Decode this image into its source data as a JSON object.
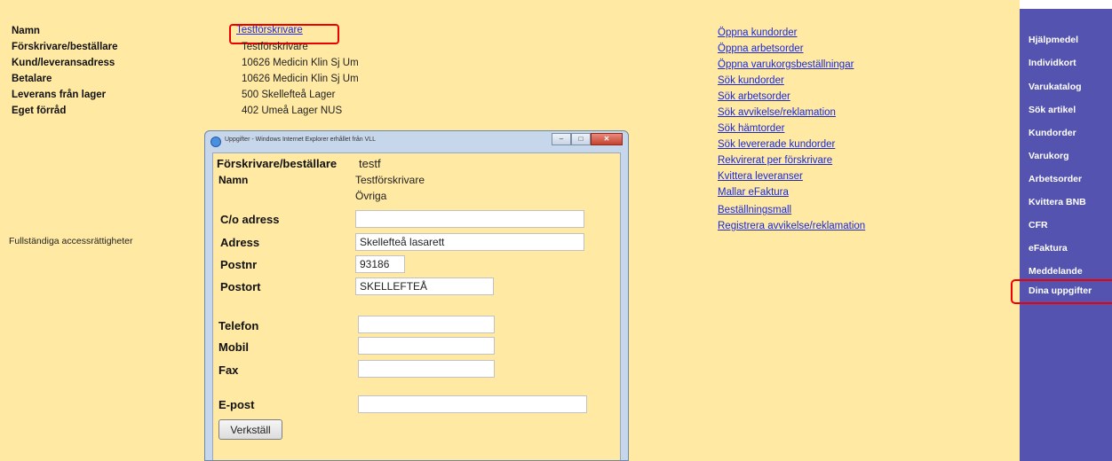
{
  "info": {
    "rows": [
      {
        "label": "Namn",
        "value": ""
      },
      {
        "label": "Förskrivare/beställare",
        "value": "Testförskrivare"
      },
      {
        "label": "Kund/leveransadress",
        "value": "10626 Medicin Klin Sj Um"
      },
      {
        "label": "Betalare",
        "value": "10626 Medicin Klin Sj Um"
      },
      {
        "label": "Leverans från lager",
        "value": "500 Skellefteå Lager"
      },
      {
        "label": "Eget förråd",
        "value": "402 Umeå Lager NUS"
      }
    ],
    "name_link": "Testförskrivare",
    "access_text": "Fullständiga accessrättigheter"
  },
  "links": [
    "Öppna kundorder",
    "Öppna arbetsorder",
    "Öppna varukorgsbeställningar",
    "Sök kundorder",
    "Sök arbetsorder",
    "Sök avvikelse/reklamation",
    "Sök hämtorder",
    "Sök levererade kundorder",
    "Rekvirerat per förskrivare",
    "Kvittera leveranser",
    "Mallar eFaktura",
    "Beställningsmall",
    "Registrera avvikelse/reklamation"
  ],
  "sidebar": {
    "items": [
      "Hjälpmedel",
      "Individkort",
      "Varukatalog",
      "Sök artikel",
      "Kundorder",
      "Varukorg",
      "Arbetsorder",
      "Kvittera BNB",
      "CFR",
      "eFaktura",
      "Meddelande",
      "Dina uppgifter"
    ],
    "highlighted": "Dina uppgifter"
  },
  "popup": {
    "title": "Uppgifter - Windows Internet Explorer erhållet från VLL",
    "forskrivare_label": "Förskrivare/beställare",
    "forskrivare_value": "testf",
    "namn_label": "Namn",
    "namn_value": "Testförskrivare",
    "namn_value2": "Övriga",
    "fields": {
      "co_adress": {
        "label": "C/o adress",
        "value": ""
      },
      "adress": {
        "label": "Adress",
        "value": "Skellefteå lasarett"
      },
      "postnr": {
        "label": "Postnr",
        "value": "93186"
      },
      "postort": {
        "label": "Postort",
        "value": "SKELLEFTEÅ"
      },
      "telefon": {
        "label": "Telefon",
        "value": ""
      },
      "mobil": {
        "label": "Mobil",
        "value": ""
      },
      "fax": {
        "label": "Fax",
        "value": ""
      },
      "epost": {
        "label": "E-post",
        "value": ""
      }
    },
    "apply_button": "Verkställ"
  },
  "colors": {
    "page_bg": "#ffe9a3",
    "sidebar_bg": "#5454b0",
    "link": "#1a2ad6",
    "highlight": "#e00000"
  }
}
